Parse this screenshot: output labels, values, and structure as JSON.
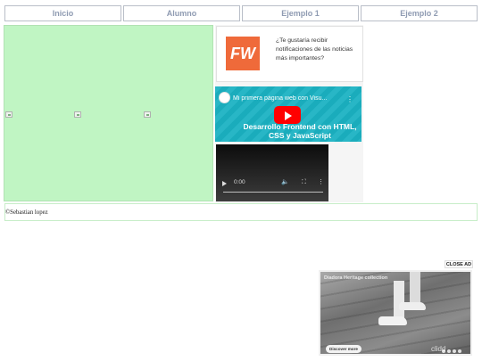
{
  "nav": {
    "items": [
      "Inicio",
      "Alumno",
      "Ejemplo 1",
      "Ejemplo 2"
    ]
  },
  "ad_card": {
    "logo_text": "FW",
    "text": "¿Te gustaría recibir notificaciones de las noticias más importantes?"
  },
  "youtube_embed": {
    "title": "Mi primera página web con Visu...",
    "headline": "Desarrollo Frontend con HTML, CSS y JavaScript",
    "menu": "⋮"
  },
  "video_player": {
    "time": "0:00"
  },
  "footer": {
    "text": "©Sebastian lopez"
  },
  "overlay_ad": {
    "close_label": "CLOSE AD",
    "title": "Diadora Heritage collection",
    "cta": "Discover more",
    "logo": "clidd"
  },
  "colors": {
    "nav_text": "#8f9bb2",
    "green_panel": "#c0f5c3",
    "fw_logo": "#ef6a3a",
    "youtube_bg": "#1bb2c2",
    "youtube_play": "#ff0000"
  }
}
